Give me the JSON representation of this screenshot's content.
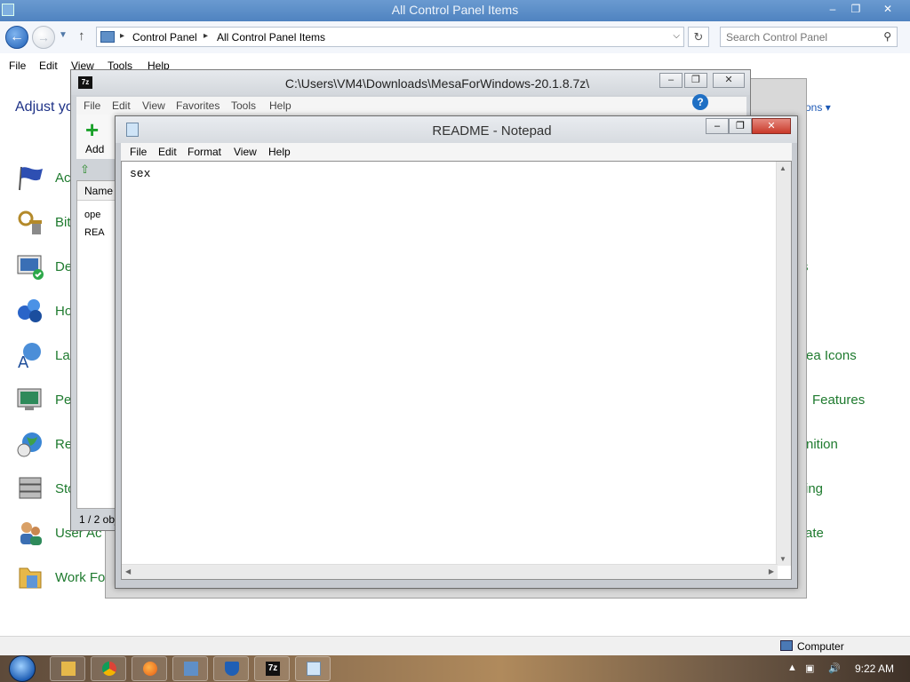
{
  "control_panel": {
    "window_title": "All Control Panel Items",
    "breadcrumbs": [
      "Control Panel",
      "All Control Panel Items"
    ],
    "search_placeholder": "Search Control Panel",
    "menu": [
      "File",
      "Edit",
      "View",
      "Tools",
      "Help"
    ],
    "heading": "Adjust yo",
    "view_by": "ons",
    "items_left": [
      {
        "label": "Ac",
        "icon": "action-center-flag-icon"
      },
      {
        "label": "Bit",
        "icon": "bitlocker-keys-icon"
      },
      {
        "label": "De",
        "icon": "device-manager-icon"
      },
      {
        "label": "Ho",
        "icon": "homegroup-icon"
      },
      {
        "label": "La",
        "icon": "language-icon"
      },
      {
        "label": "Pe",
        "icon": "personalization-icon"
      },
      {
        "label": "Re",
        "icon": "region-globe-icon"
      },
      {
        "label": "Sto",
        "icon": "storage-spaces-icon"
      },
      {
        "label": "User Ac",
        "icon": "user-accounts-icon"
      },
      {
        "label": "Work Fo",
        "icon": "work-folders-icon"
      }
    ],
    "items_right": [
      "s",
      "rea Icons",
      "Features",
      "nition",
      "ing",
      "ate"
    ],
    "status": "Computer"
  },
  "zip": {
    "window_title": "C:\\Users\\VM4\\Downloads\\MesaForWindows-20.1.8.7z\\",
    "menu": [
      "File",
      "Edit",
      "View",
      "Favorites",
      "Tools",
      "Help"
    ],
    "add_label": "Add",
    "column_name": "Name",
    "rows": [
      "ope",
      "REA"
    ],
    "status": "1 / 2 obj"
  },
  "notepad": {
    "window_title": "README - Notepad",
    "menu": [
      "File",
      "Edit",
      "Format",
      "View",
      "Help"
    ],
    "content": "sex"
  },
  "taskbar": {
    "apps": [
      "file-explorer-icon",
      "chrome-icon",
      "firefox-icon",
      "control-panel-icon",
      "defender-shield-icon",
      "7zip-icon",
      "notepad-icon"
    ],
    "clock": "9:22 AM"
  }
}
